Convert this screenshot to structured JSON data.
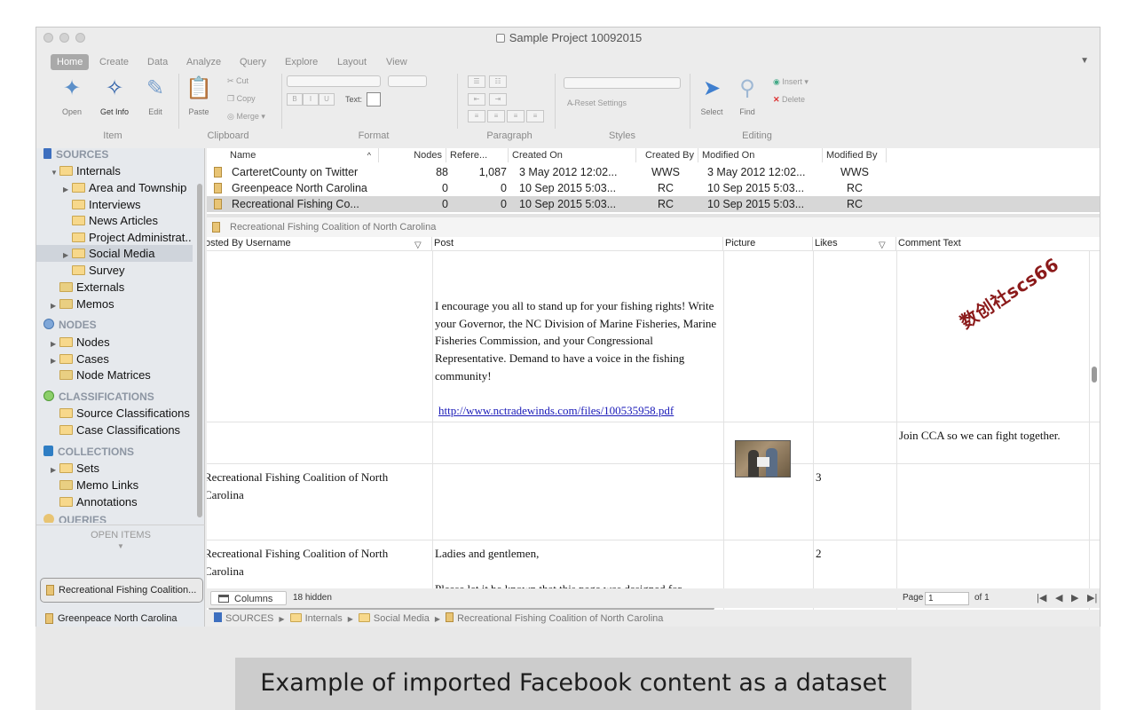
{
  "window": {
    "title": "Sample Project 10092015"
  },
  "ribbon": {
    "tabs": [
      "Home",
      "Create",
      "Data",
      "Analyze",
      "Query",
      "Explore",
      "Layout",
      "View"
    ],
    "item": {
      "open": "Open",
      "get_info": "Get Info",
      "edit": "Edit",
      "label": "Item"
    },
    "clipboard": {
      "paste": "Paste",
      "cut": "Cut",
      "copy": "Copy",
      "merge": "Merge",
      "label": "Clipboard"
    },
    "format": {
      "text": "Text:",
      "bold": "B",
      "italic": "I",
      "underline": "U",
      "label": "Format"
    },
    "paragraph": {
      "label": "Paragraph"
    },
    "styles": {
      "reset": "Reset Settings",
      "label": "Styles"
    },
    "editing": {
      "select": "Select",
      "find": "Find",
      "insert": "Insert",
      "delete": "Delete",
      "label": "Editing"
    }
  },
  "sidebar": {
    "sources": {
      "label": "SOURCES",
      "internals": "Internals",
      "children": [
        "Area and Township",
        "Interviews",
        "News Articles",
        "Project Administrat..",
        "Social Media",
        "Survey"
      ],
      "externals": "Externals",
      "memos": "Memos"
    },
    "nodes": {
      "label": "NODES",
      "items": [
        "Nodes",
        "Cases",
        "Node Matrices"
      ]
    },
    "classifications": {
      "label": "CLASSIFICATIONS",
      "items": [
        "Source Classifications",
        "Case Classifications"
      ]
    },
    "collections": {
      "label": "COLLECTIONS",
      "items": [
        "Sets",
        "Memo Links",
        "Annotations"
      ]
    },
    "queries": {
      "label": "QUERIES"
    },
    "open_items": {
      "label": "OPEN ITEMS",
      "items": [
        "Recreational Fishing Coalition...",
        "Greenpeace North Carolina"
      ]
    }
  },
  "list": {
    "columns": [
      "Name",
      "Nodes",
      "Refere...",
      "Created On",
      "Created By",
      "Modified On",
      "Modified By"
    ],
    "rows": [
      {
        "name": "CarteretCounty on Twitter",
        "nodes": "88",
        "refs": "1,087",
        "created_on": "3 May 2012 12:02...",
        "created_by": "WWS",
        "modified_on": "3 May 2012 12:02...",
        "modified_by": "WWS"
      },
      {
        "name": "Greenpeace North Carolina",
        "nodes": "0",
        "refs": "0",
        "created_on": "10 Sep 2015 5:03...",
        "created_by": "RC",
        "modified_on": "10 Sep 2015 5:03...",
        "modified_by": "RC"
      },
      {
        "name": "Recreational Fishing Co...",
        "nodes": "0",
        "refs": "0",
        "created_on": "10 Sep 2015 5:03...",
        "created_by": "RC",
        "modified_on": "10 Sep 2015 5:03...",
        "modified_by": "RC"
      }
    ]
  },
  "dataset": {
    "title": "Recreational Fishing Coalition of North Carolina",
    "columns": [
      "osted By Username",
      "Post",
      "Picture",
      "Likes",
      "Comment Text"
    ],
    "row1_post": "I encourage you all to stand up for your fishing rights! Write your Governor, the NC Division of Marine Fisheries, Marine Fisheries Commission, and your Congressional Representative. Demand to have a voice in the fishing community!",
    "row1_link": "http://www.nctradewinds.com/files/100535958.pdf",
    "row2_comment": "Join CCA so we can fight together.",
    "row3_user": "Recreational Fishing Coalition of North Carolina",
    "row3_likes": "3",
    "row4_user": "Recreational Fishing Coalition of North Carolina",
    "row4_post_line1": "Ladies and gentlemen,",
    "row4_post_line2": "Please let it be known that this page was designed for",
    "row4_likes": "2",
    "watermark": "数创社scs66"
  },
  "bottombar": {
    "columns": "Columns",
    "hidden": "18 hidden",
    "page_label": "Page",
    "page_value": "1",
    "of": "of  1"
  },
  "breadcrumb": [
    "SOURCES",
    "Internals",
    "Social Media",
    "Recreational Fishing Coalition of North Carolina"
  ],
  "caption": "Example of imported Facebook content as a dataset"
}
